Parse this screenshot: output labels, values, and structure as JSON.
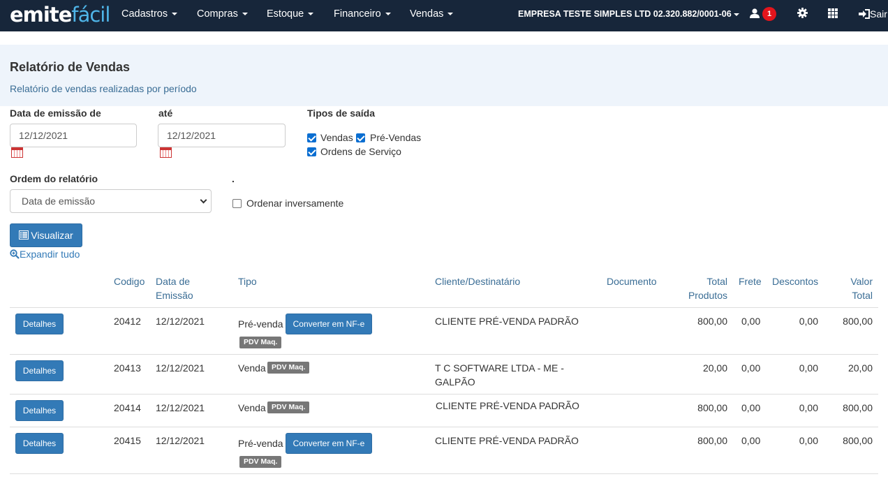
{
  "navbar": {
    "logo_main": "emite",
    "logo_accent": "fácil",
    "menus": [
      "Cadastros",
      "Compras",
      "Estoque",
      "Financeiro",
      "Vendas"
    ],
    "company": "EMPRESA TESTE SIMPLES LTD 02.320.882/0001-06",
    "notification_count": "1",
    "logout": "Sair"
  },
  "header": {
    "title": "Relatório de Vendas",
    "subtitle": "Relatório de vendas realizadas por período"
  },
  "form": {
    "date_from_label": "Data de emissão de",
    "date_from_value": "12/12/2021",
    "date_to_label": "até",
    "date_to_value": "12/12/2021",
    "types_label": "Tipos de saída",
    "type_vendas": "Vendas",
    "type_prevendas": "Pré-Vendas",
    "type_os": "Ordens de Serviço",
    "order_label": "Ordem do relatório",
    "order_value": "Data de emissão",
    "dot_label": ".",
    "reverse_label": "Ordenar inversamente",
    "view_button": "Visualizar",
    "expand_link": "Expandir tudo"
  },
  "table": {
    "headers": {
      "codigo": "Codigo",
      "data1": "Data de",
      "data2": "Emissão",
      "tipo": "Tipo",
      "cliente": "Cliente/Destinatário",
      "documento": "Documento",
      "total1": "Total",
      "total2": "Produtos",
      "frete": "Frete",
      "descontos": "Descontos",
      "valor1": "Valor",
      "valor2": "Total"
    },
    "details_label": "Detalhes",
    "convert_label": "Converter em NF-e",
    "rows": [
      {
        "codigo": "20412",
        "data": "12/12/2021",
        "tipo": "Pré-venda",
        "tag": "PDV Maq.",
        "cliente": "CLIENTE PRÉ-VENDA PADRÃO",
        "cliente2": "",
        "total": "800,00",
        "frete": "0,00",
        "descontos": "0,00",
        "valor": "800,00"
      },
      {
        "codigo": "20413",
        "data": "12/12/2021",
        "tipo": "Venda",
        "tag": "PDV Maq.",
        "cliente": "T C SOFTWARE LTDA - ME -",
        "cliente2": "GALPÃO",
        "total": "20,00",
        "frete": "0,00",
        "descontos": "0,00",
        "valor": "20,00"
      },
      {
        "codigo": "20414",
        "data": "12/12/2021",
        "tipo": "Venda",
        "tag": "PDV Maq.",
        "cliente": "CLIENTE PRÉ-VENDA PADRÃO",
        "cliente2": "",
        "total": "800,00",
        "frete": "0,00",
        "descontos": "0,00",
        "valor": "800,00"
      },
      {
        "codigo": "20415",
        "data": "12/12/2021",
        "tipo": "Pré-venda",
        "tag": "PDV Maq.",
        "cliente": "CLIENTE PRÉ-VENDA PADRÃO",
        "cliente2": "",
        "total": "800,00",
        "frete": "0,00",
        "descontos": "0,00",
        "valor": "800,00"
      }
    ]
  }
}
